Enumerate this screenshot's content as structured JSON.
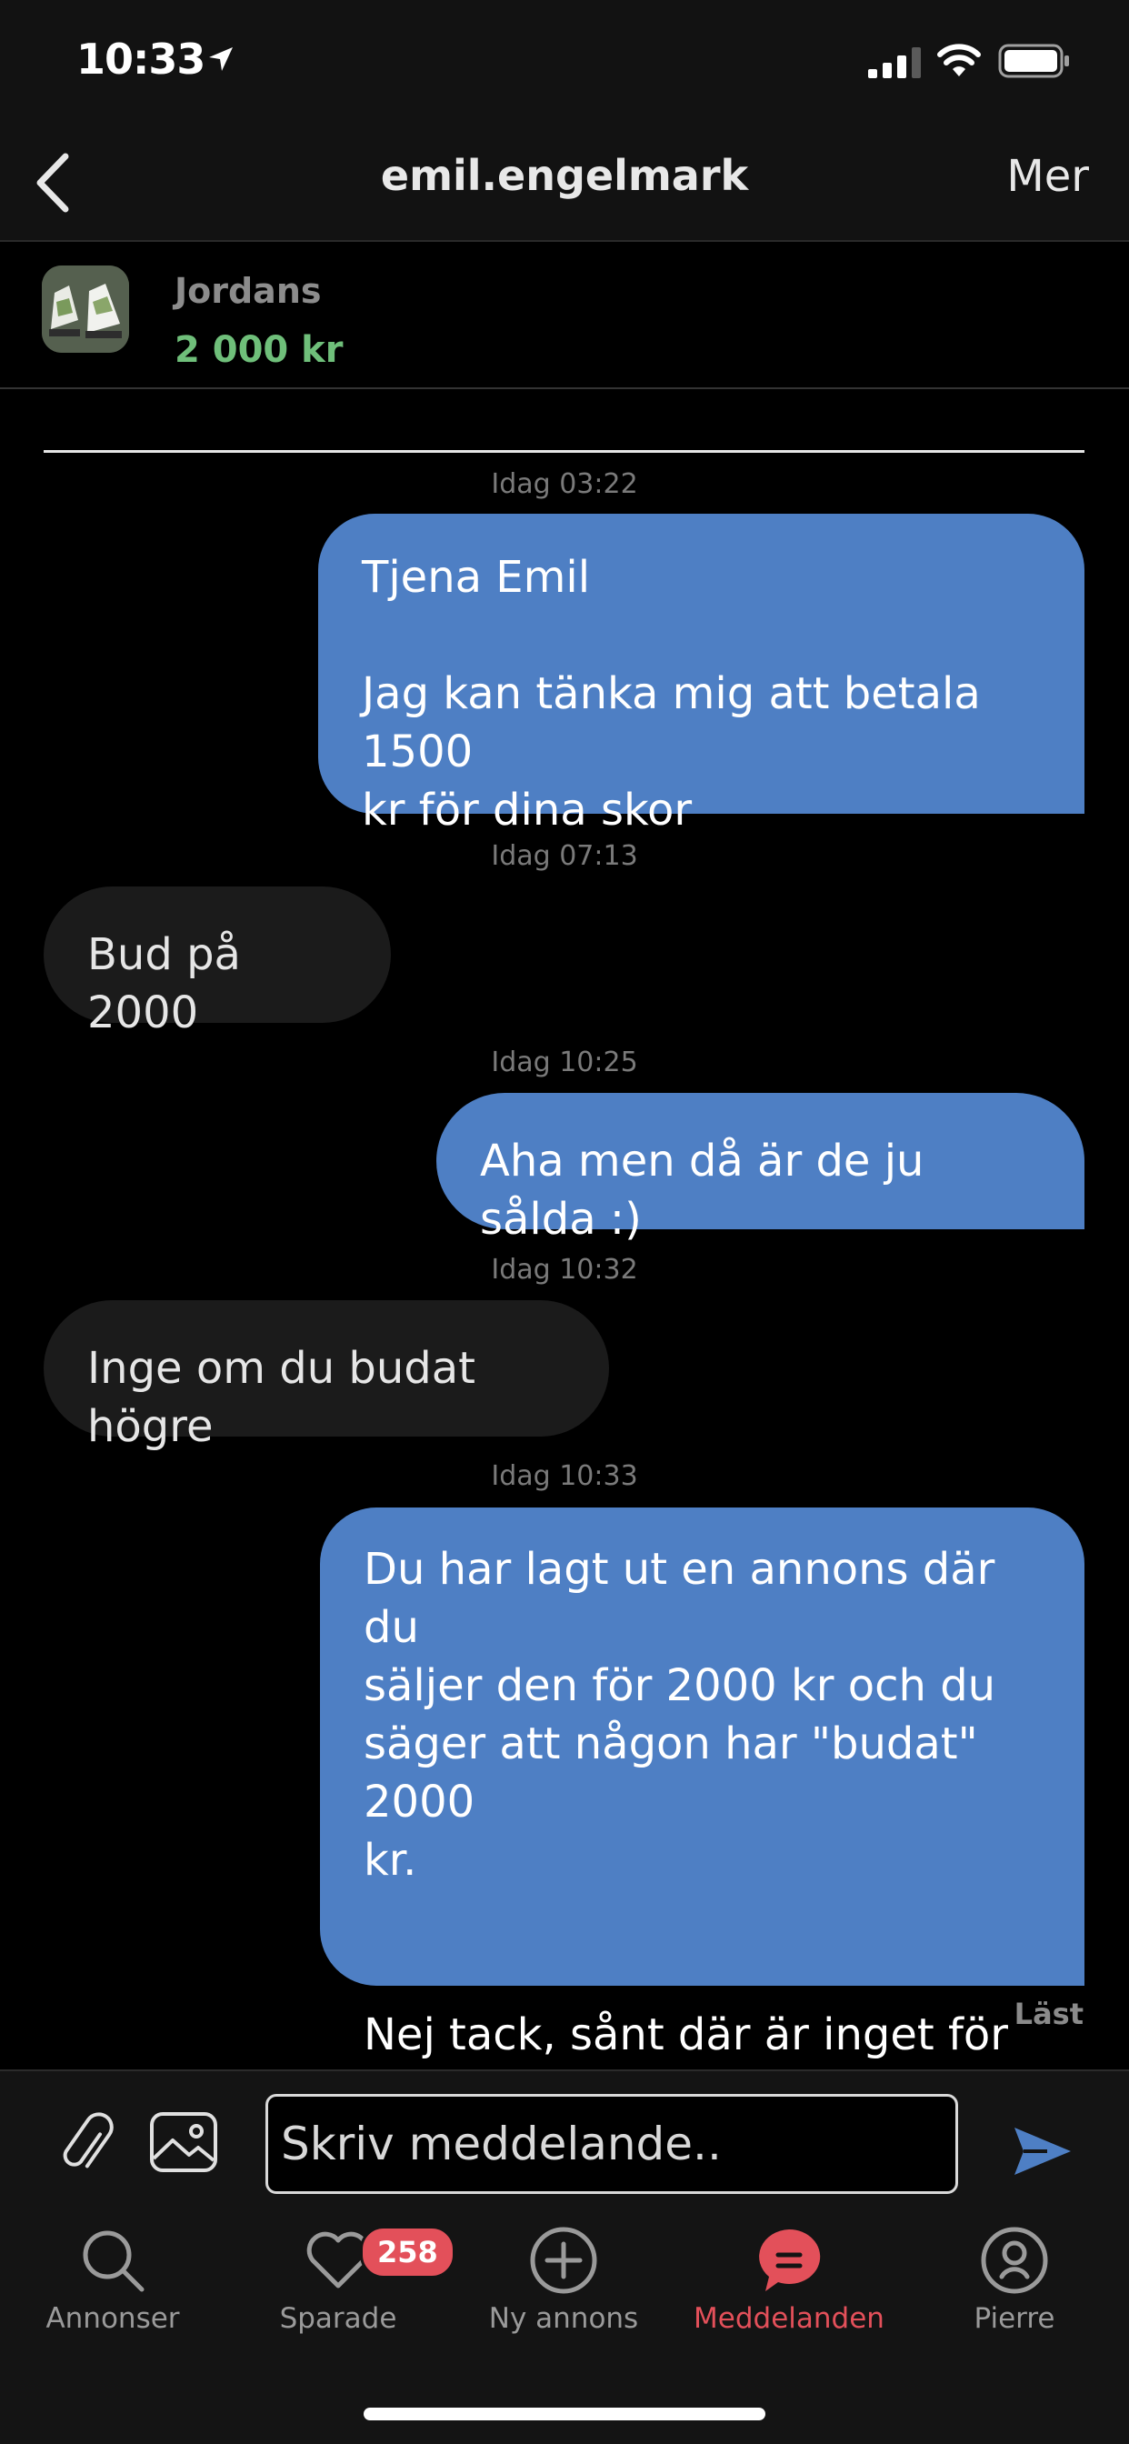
{
  "status_bar": {
    "time": "10:33"
  },
  "header": {
    "title": "emil.engelmark",
    "more_label": "Mer"
  },
  "listing": {
    "title": "Jordans",
    "price": "2 000 kr"
  },
  "messages": [
    {
      "timestamp": "Idag 03:22",
      "direction": "outgoing",
      "text": "Tjena Emil\n\nJag kan tänka mig att betala 1500\nkr för dina skor"
    },
    {
      "timestamp": "Idag 07:13",
      "direction": "incoming",
      "text": "Bud på 2000"
    },
    {
      "timestamp": "Idag 10:25",
      "direction": "outgoing",
      "text": "Aha men då är de ju sålda :)"
    },
    {
      "timestamp": "Idag 10:32",
      "direction": "incoming",
      "text": "Inge om du budat högre"
    },
    {
      "timestamp": "Idag 10:33",
      "direction": "outgoing",
      "text": "Du har lagt ut en annons där du\nsäljer den för 2000 kr och du\nsäger att någon har \"budat\" 2000\nkr.\n\n\nNej tack, sånt där är inget för mig"
    }
  ],
  "read_receipt": "Läst",
  "composer": {
    "placeholder": "Skriv meddelande.."
  },
  "tabs": [
    {
      "label": "Annonser",
      "icon": "search-icon"
    },
    {
      "label": "Sparade",
      "icon": "heart-icon",
      "badge": "258"
    },
    {
      "label": "Ny annons",
      "icon": "plus-circle-icon"
    },
    {
      "label": "Meddelanden",
      "icon": "message-icon",
      "active": true
    },
    {
      "label": "Pierre",
      "icon": "profile-icon"
    }
  ],
  "colors": {
    "outgoing_bubble": "#4e7fc4",
    "incoming_bubble": "#1b1b1b",
    "price_green": "#6fbf7a",
    "accent_red": "#e3505a"
  }
}
